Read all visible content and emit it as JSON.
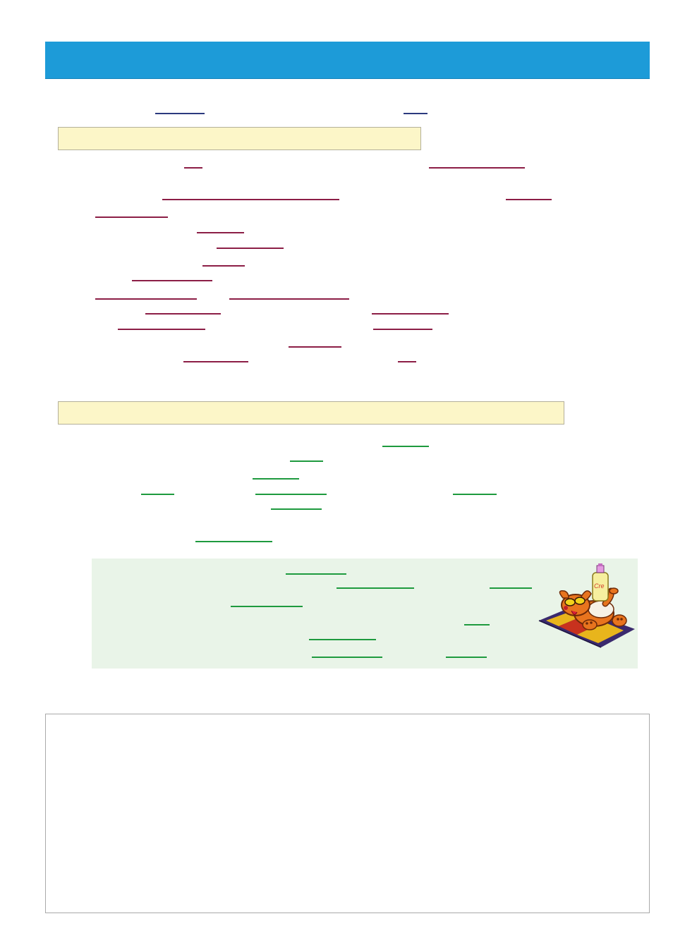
{
  "page": {
    "background": "#ffffff"
  },
  "header": {
    "color": "#1d9bd8"
  },
  "sections": [
    {
      "id": "section-1",
      "color": "#fcf6c8",
      "blank_color": "#8c1e46",
      "blank_count": 23
    },
    {
      "id": "section-2",
      "color": "#fcf6c8",
      "blank_color": "#1e9a3e",
      "blank_count": 9
    }
  ],
  "intro": {
    "blank_color": "#2c3a7e",
    "blank_count": 2
  },
  "tip_panel": {
    "color": "#e9f4e8",
    "blank_color": "#1e9a3e",
    "blank_count": 9,
    "illustration": "cartoon-dog-sunbathing-with-cream-bottle",
    "bottle_label": "Cre"
  },
  "answer_box": {
    "border_color": "#a9a9a9"
  }
}
